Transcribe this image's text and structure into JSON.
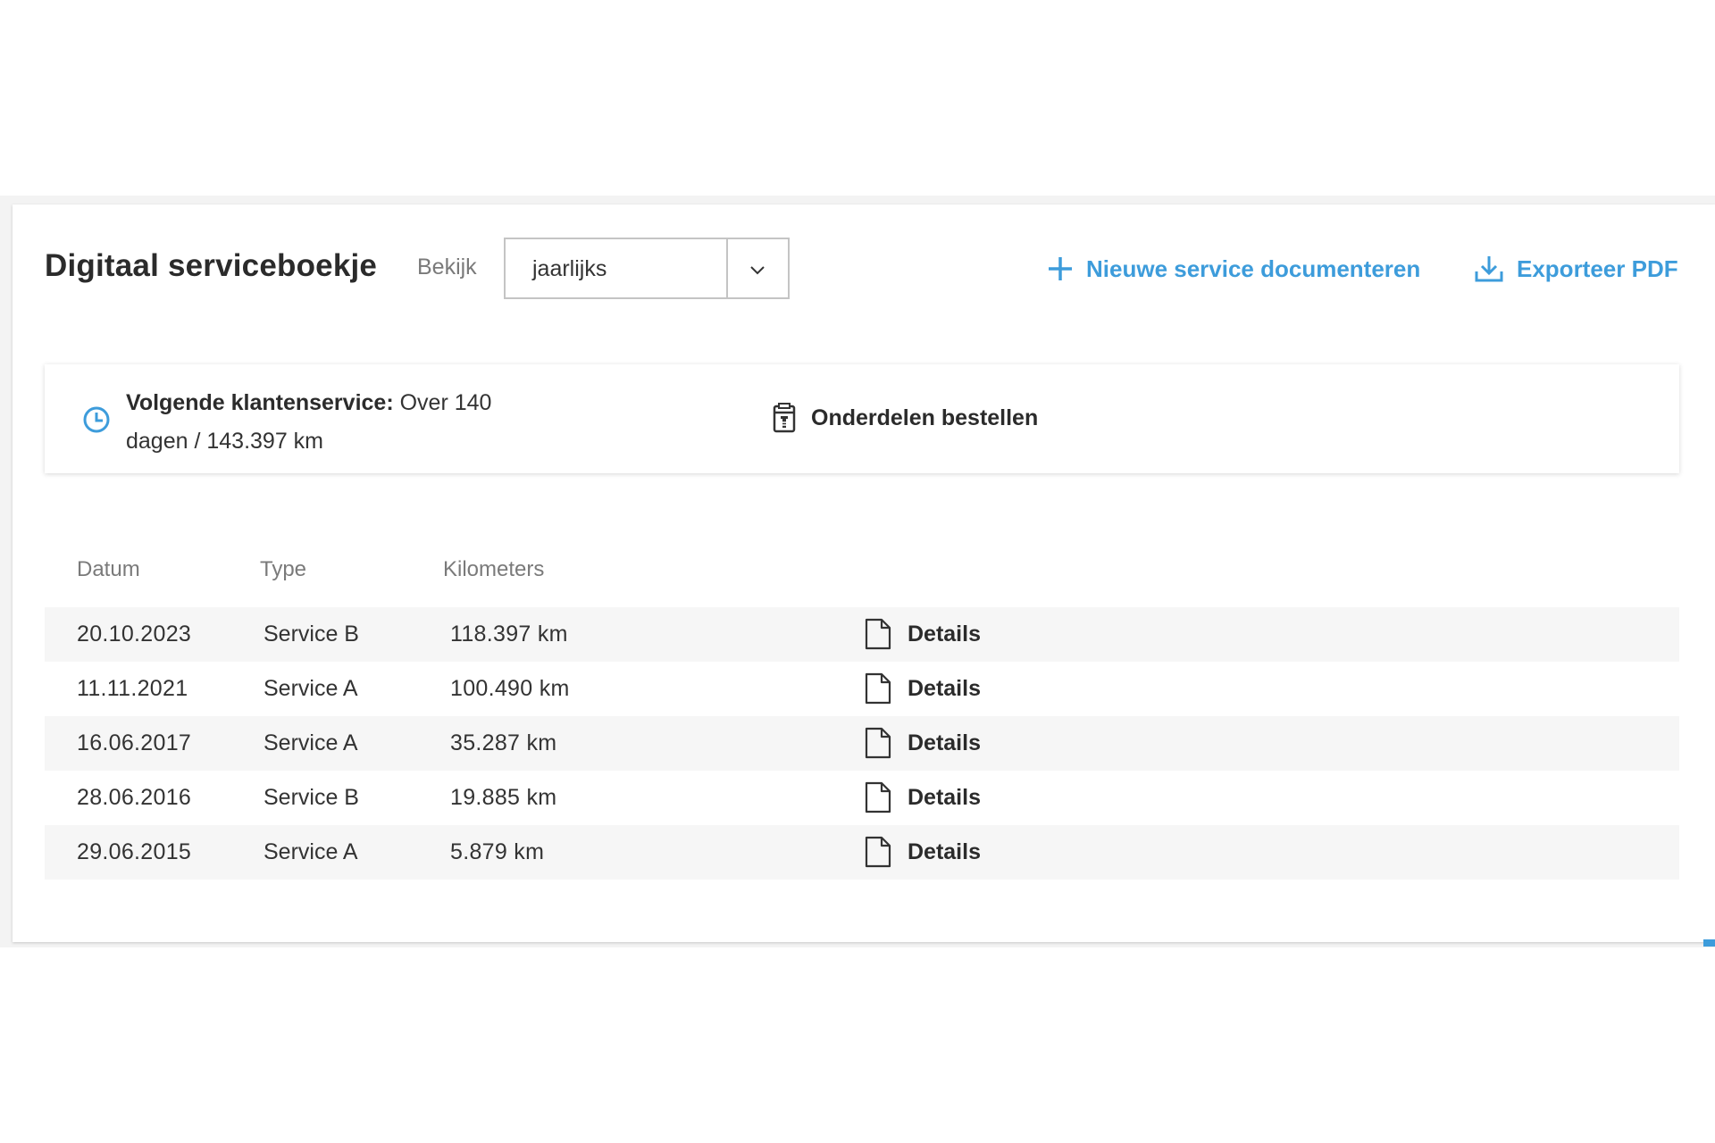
{
  "header": {
    "title": "Digitaal serviceboekje",
    "view_label": "Bekijk",
    "view_select": {
      "value": "jaarlijks"
    },
    "actions": {
      "new_service": {
        "label": "Nieuwe service documenteren",
        "icon": "plus-icon"
      },
      "export_pdf": {
        "label": "Exporteer PDF",
        "icon": "download-icon"
      }
    }
  },
  "next_service": {
    "label": "Volgende klantenservice:",
    "value_line1": "Over 140",
    "value_line2": "dagen / 143.397 km",
    "icon": "clock-icon"
  },
  "order_parts": {
    "label": "Onderdelen bestellen",
    "icon": "parts-list-icon"
  },
  "table": {
    "columns": [
      "Datum",
      "Type",
      "Kilometers"
    ],
    "rows": [
      {
        "date": "20.10.2023",
        "type": "Service B",
        "km": "118.397 km",
        "details": "Details"
      },
      {
        "date": "11.11.2021",
        "type": "Service A",
        "km": "100.490 km",
        "details": "Details"
      },
      {
        "date": "16.06.2017",
        "type": "Service A",
        "km": "35.287 km",
        "details": "Details"
      },
      {
        "date": "28.06.2016",
        "type": "Service B",
        "km": "19.885 km",
        "details": "Details"
      },
      {
        "date": "29.06.2015",
        "type": "Service A",
        "km": "5.879 km",
        "details": "Details"
      }
    ]
  },
  "colors": {
    "accent": "#3d9cdb",
    "text": "#333333",
    "muted": "#7a7a7a",
    "row_alt": "#f6f6f6"
  }
}
